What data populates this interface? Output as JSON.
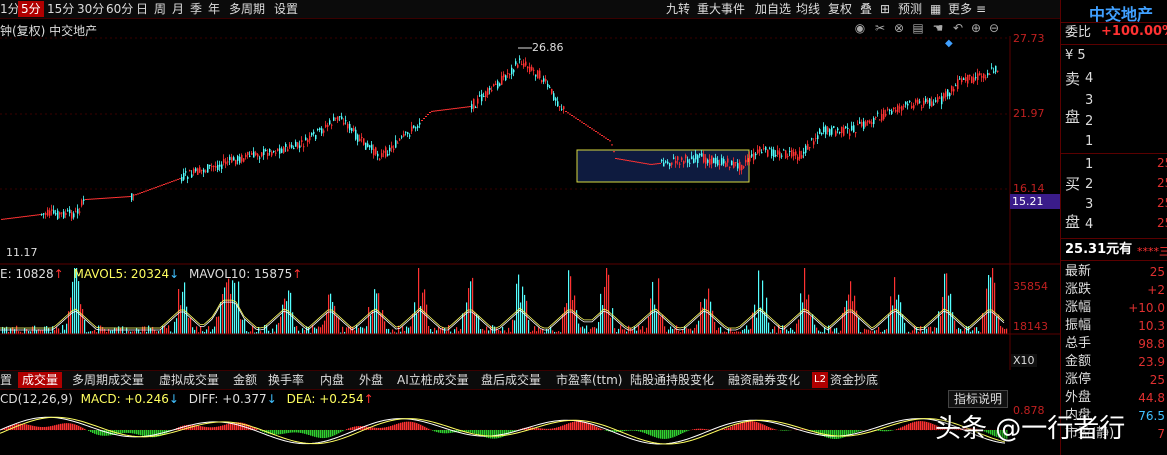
{
  "toolbar": {
    "left_items": [
      "1分",
      "5分",
      "15分",
      "30分",
      "60分",
      "日",
      "周",
      "月",
      "季",
      "年",
      "多周期",
      "设置"
    ],
    "active_index": 1,
    "right_items": [
      "九转",
      "重大事件",
      "加自选",
      "均线",
      "复权",
      "叠",
      "预测",
      "更多"
    ]
  },
  "chart": {
    "title": "钟(复权)  中交地产",
    "high_label": "26.86",
    "low_label": "11.17",
    "current_price_tag": "15.21",
    "axis_labels": [
      "27.73",
      "21.97",
      "16.14"
    ],
    "vol_axis_labels": [
      "35854",
      "18143"
    ],
    "vol_unit": "X10",
    "macd_axis_label": "0.878",
    "colors": {
      "up": "#ff3232",
      "down": "#54ffff",
      "accent": "#b00000"
    }
  },
  "volume_legend": {
    "vol": "E: 10828",
    "mavol5": "MAVOL5: 20324",
    "mavol10": "MAVOL10: 15875"
  },
  "indicator_tabs": {
    "items": [
      "置",
      "成交量",
      "多周期成交量",
      "虚拟成交量",
      "金额",
      "换手率",
      "内盘",
      "外盘",
      "AI立桩成交量",
      "盘后成交量",
      "市盈率(ttm)",
      "陆股通持股变化",
      "融资融券变化",
      "L2",
      "资金抄底"
    ],
    "active_index": 1,
    "help": "指标说明"
  },
  "macd_legend": {
    "name": "CD(12,26,9)",
    "macd": "MACD: +0.246",
    "diff": "DIFF: +0.377",
    "dea": "DEA: +0.254"
  },
  "quote": {
    "stock_name": "中交地产",
    "weibi_label": "委比",
    "weibi_value": "+100.00%",
    "sell_label_1": "卖",
    "sell_label_2": "盘",
    "sell_levels": [
      "¥ 5",
      "4",
      "3",
      "2",
      "1"
    ],
    "buy_label_1": "买",
    "buy_label_2": "盘",
    "buy_levels": [
      "1",
      "2",
      "3",
      "4"
    ],
    "buy_values": [
      "25",
      "25",
      "25",
      "25"
    ],
    "limit_row": "25.31元有",
    "limit_stars": "****三",
    "fields": [
      {
        "label": "最新",
        "value": "25"
      },
      {
        "label": "涨跌",
        "value": "+2"
      },
      {
        "label": "涨幅",
        "value": "+10.0"
      },
      {
        "label": "振幅",
        "value": "10.3"
      },
      {
        "label": "总手",
        "value": "98.8"
      },
      {
        "label": "金额",
        "value": "23.9"
      },
      {
        "label": "涨停",
        "value": "25"
      },
      {
        "label": "外盘",
        "value": "44.8"
      },
      {
        "label": "内盘",
        "value": "76.5"
      },
      {
        "label": "市盈(静)",
        "value": "7"
      }
    ]
  },
  "watermark": "头条 @一行者行"
}
